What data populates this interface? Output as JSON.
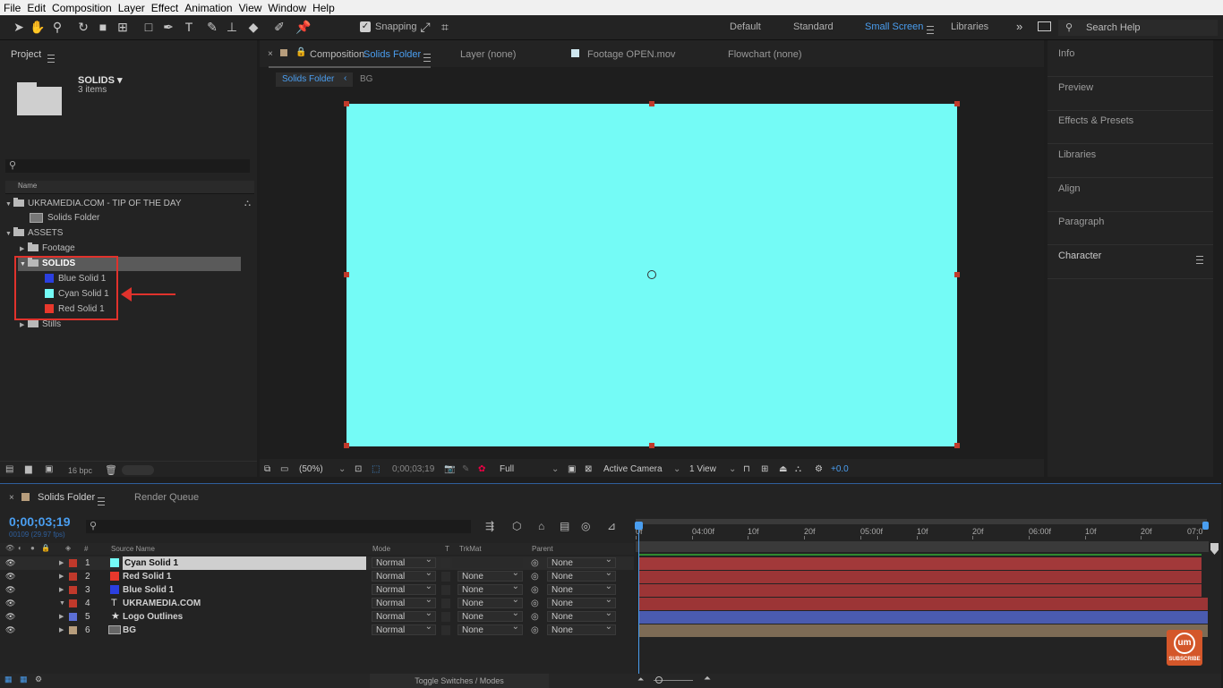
{
  "menu": [
    "File",
    "Edit",
    "Composition",
    "Layer",
    "Effect",
    "Animation",
    "View",
    "Window",
    "Help"
  ],
  "toolbar": {
    "snapping_label": "Snapping",
    "workspaces": [
      "Default",
      "Standard",
      "Small Screen",
      "Libraries"
    ],
    "search_placeholder": "Search Help"
  },
  "project": {
    "title": "Project",
    "selected_name": "SOLIDS ▾",
    "selected_count": "3 items",
    "search_placeholder": "",
    "column_name": "Name",
    "tree": {
      "comp_folder": "UKRAMEDIA.COM - TIP OF THE DAY",
      "comp": "Solids Folder",
      "assets": "ASSETS",
      "footage": "Footage",
      "solids": "SOLIDS",
      "blue": "Blue Solid 1",
      "cyan": "Cyan Solid 1",
      "red": "Red Solid 1",
      "stills": "Stills"
    },
    "bpc": "16 bpc"
  },
  "viewer": {
    "tab_composition_prefix": "Composition",
    "tab_composition_name": "Solids Folder",
    "tab_layer": "Layer  (none)",
    "tab_footage": "Footage  OPEN.mov",
    "tab_flowchart": "Flowchart  (none)",
    "breadcrumb_active": "Solids Folder",
    "breadcrumb_next": "BG",
    "canvas_color": "#74fbf6",
    "zoom": "(50%)",
    "timecode": "0;00;03;19",
    "resolution": "Full",
    "camera": "Active Camera",
    "views": "1 View",
    "exposure": "+0.0"
  },
  "right_panel": [
    "Info",
    "Preview",
    "Effects & Presets",
    "Libraries",
    "Align",
    "Paragraph",
    "Character"
  ],
  "timeline": {
    "tab_comp": "Solids Folder",
    "tab_render": "Render Queue",
    "timecode": "0;00;03;19",
    "frame_info": "00109 (29.97 fps)",
    "headers": {
      "num": "#",
      "source": "Source Name",
      "mode": "Mode",
      "t": "T",
      "trkmat": "TrkMat",
      "parent": "Parent"
    },
    "ruler": [
      "0f",
      "04:00f",
      "10f",
      "20f",
      "05:00f",
      "10f",
      "20f",
      "06:00f",
      "10f",
      "20f",
      "07:0"
    ],
    "layers": [
      {
        "num": "1",
        "name": "Cyan Solid 1",
        "label": "#c0392b",
        "icon": "#74fbf6",
        "mode": "Normal",
        "trkmat": "",
        "parent": "None",
        "bar": "#a2393a"
      },
      {
        "num": "2",
        "name": "Red Solid 1",
        "label": "#c0392b",
        "icon": "#e8382c",
        "mode": "Normal",
        "trkmat": "None",
        "parent": "None",
        "bar": "#9c3536"
      },
      {
        "num": "3",
        "name": "Blue Solid 1",
        "label": "#c0392b",
        "icon": "#2b3fe0",
        "mode": "Normal",
        "trkmat": "None",
        "parent": "None",
        "bar": "#9c3536"
      },
      {
        "num": "4",
        "name": "UKRAMEDIA.COM",
        "label": "#c0392b",
        "icon": "T",
        "mode": "Normal",
        "trkmat": "None",
        "parent": "None",
        "bar": "#9c3536"
      },
      {
        "num": "5",
        "name": "Logo Outlines",
        "label": "#5c6fd6",
        "icon": "★",
        "mode": "Normal",
        "trkmat": "None",
        "parent": "None",
        "bar": "#4a5bb0"
      },
      {
        "num": "6",
        "name": "BG",
        "label": "#b79d7c",
        "icon": "img",
        "mode": "Normal",
        "trkmat": "None",
        "parent": "None",
        "bar": "#7d6b55"
      }
    ],
    "footer": "Toggle Switches / Modes"
  },
  "badge": {
    "text": "SUBSCRIBE",
    "logo": "um"
  }
}
